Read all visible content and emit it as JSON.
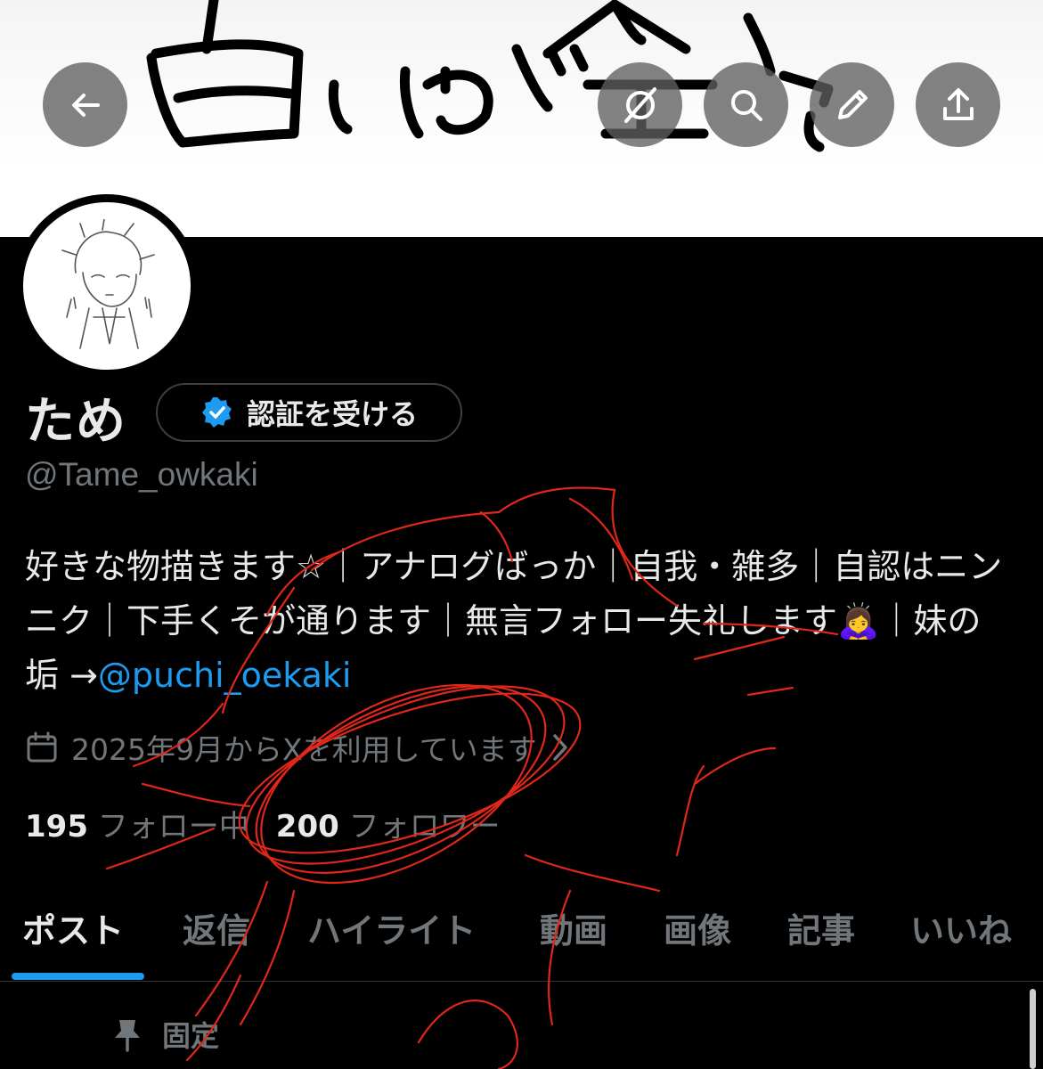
{
  "profile": {
    "display_name": "ため",
    "verify_label": "認証を受ける",
    "handle": "@Tame_owkaki",
    "bio_text": "好きな物描きます☆｜アナログばっか｜自我・雑多｜自認はニンニク｜下手くそが通ります｜無言フォロー失礼します🙇‍♀️｜妹の垢 →",
    "bio_mention": "@puchi_oekaki",
    "joined": "2025年9月からXを利用しています",
    "following_count": "195",
    "following_label": "フォロー中",
    "followers_count": "200",
    "followers_label": "フォロワー"
  },
  "tabs": [
    {
      "label": "ポスト"
    },
    {
      "label": "返信"
    },
    {
      "label": "ハイライト"
    },
    {
      "label": "動画"
    },
    {
      "label": "画像"
    },
    {
      "label": "記事"
    },
    {
      "label": "いいね"
    }
  ],
  "pinned": {
    "label": "固定"
  },
  "icons": {
    "back": "arrow-left-icon",
    "grok": "grok-icon",
    "search": "search-icon",
    "edit": "pencil-icon",
    "share": "share-icon",
    "verified": "verified-badge-icon",
    "calendar": "calendar-icon",
    "chevron": "chevron-right-icon",
    "pin": "pin-icon"
  },
  "colors": {
    "accent": "#1d9bf0",
    "background": "#000000",
    "muted_text": "#71767b",
    "annotation_red": "#e0271a"
  }
}
